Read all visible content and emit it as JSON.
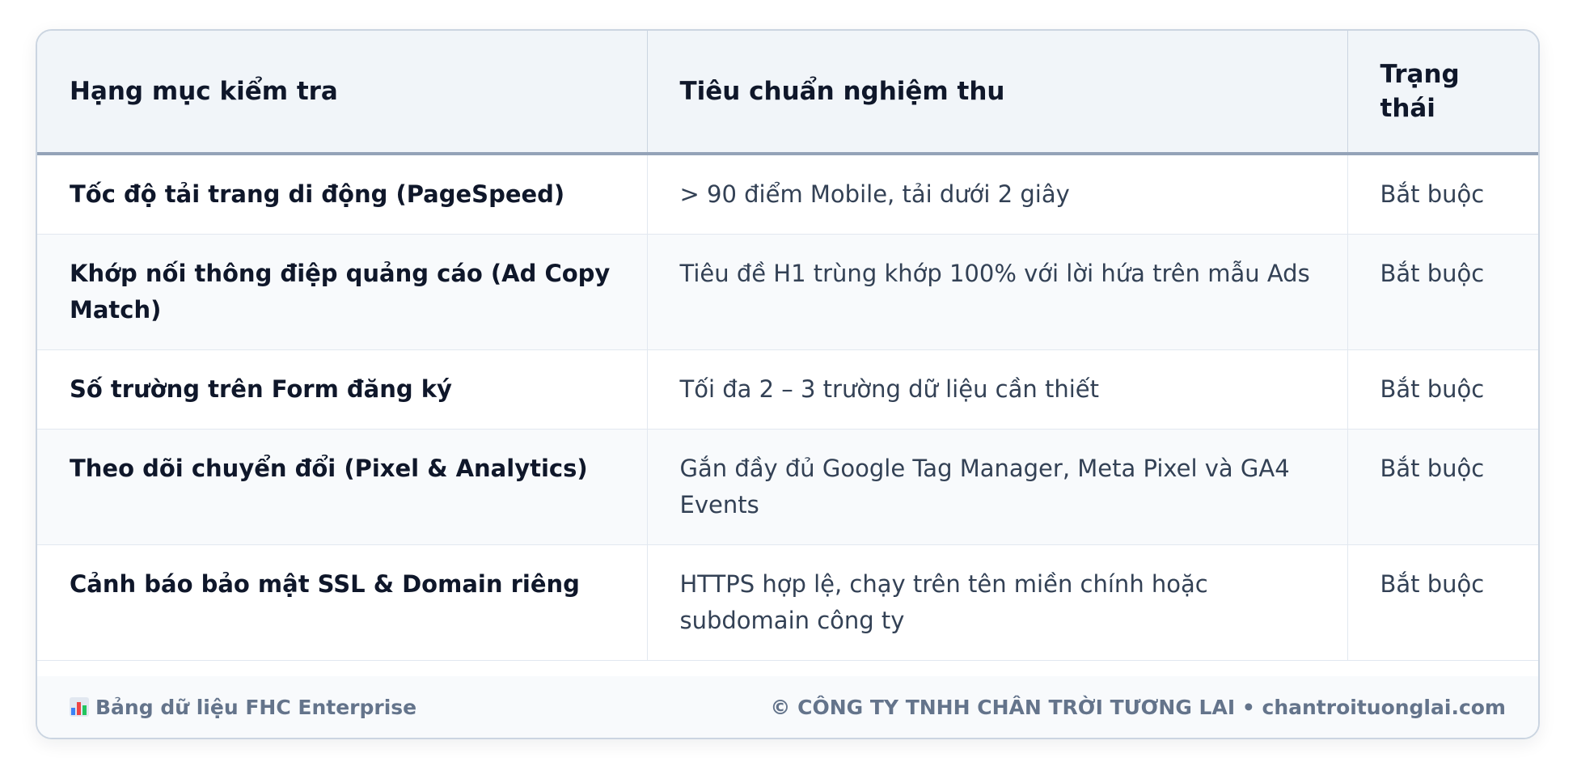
{
  "table": {
    "headers": [
      "Hạng mục kiểm tra",
      "Tiêu chuẩn nghiệm thu",
      "Trạng thái"
    ],
    "rows": [
      {
        "item": "Tốc độ tải trang di động (PageSpeed)",
        "standard": "> 90 điểm Mobile, tải dưới 2 giây",
        "status": "Bắt buộc"
      },
      {
        "item": "Khớp nối thông điệp quảng cáo (Ad Copy Match)",
        "standard": "Tiêu đề H1 trùng khớp 100% với lời hứa trên mẫu Ads",
        "status": "Bắt buộc"
      },
      {
        "item": "Số trường trên Form đăng ký",
        "standard": "Tối đa 2 – 3 trường dữ liệu cần thiết",
        "status": "Bắt buộc"
      },
      {
        "item": "Theo dõi chuyển đổi (Pixel & Analytics)",
        "standard": "Gắn đầy đủ Google Tag Manager, Meta Pixel và GA4 Events",
        "status": "Bắt buộc"
      },
      {
        "item": "Cảnh báo bảo mật SSL & Domain riêng",
        "standard": "HTTPS hợp lệ, chạy trên tên miền chính hoặc subdomain công ty",
        "status": "Bắt buộc"
      }
    ]
  },
  "footer": {
    "icon": "bar-chart-icon",
    "left_text": "Bảng dữ liệu FHC Enterprise",
    "right_text": "© CÔNG TY TNHH CHÂN TRỜI TƯƠNG LAI • chantroituonglai.com"
  }
}
